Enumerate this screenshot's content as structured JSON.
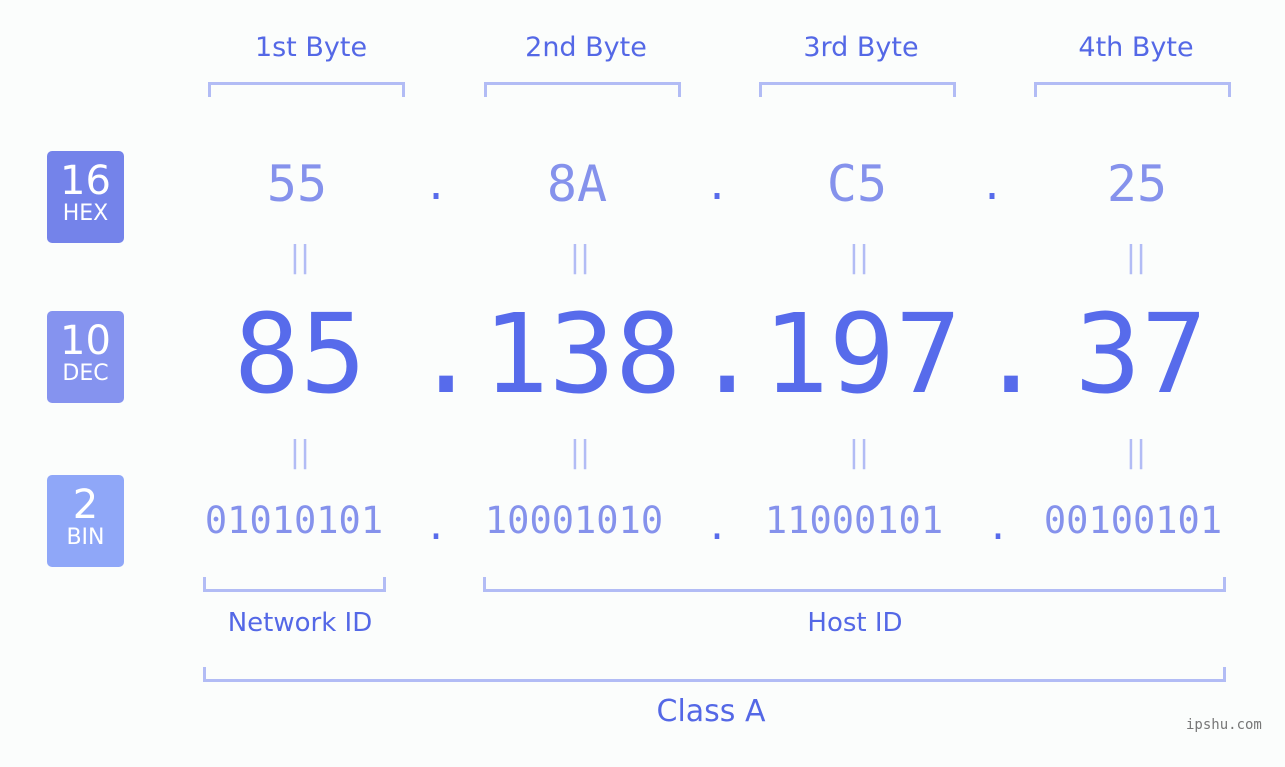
{
  "headers": [
    "1st Byte",
    "2nd Byte",
    "3rd Byte",
    "4th Byte"
  ],
  "badges": [
    {
      "num": "16",
      "label": "HEX",
      "color": "#7483ea"
    },
    {
      "num": "10",
      "label": "DEC",
      "color": "#8593ef"
    },
    {
      "num": "2",
      "label": "BIN",
      "color": "#8fa7f8"
    }
  ],
  "hex": [
    "55",
    "8A",
    "C5",
    "25"
  ],
  "dec": [
    "85",
    "138",
    "197",
    "37"
  ],
  "bin": [
    "01010101",
    "10001010",
    "11000101",
    "00100101"
  ],
  "separator": ".",
  "equals": "=",
  "network_label": "Network ID",
  "host_label": "Host ID",
  "class_label": "Class A",
  "watermark": "ipshu.com"
}
